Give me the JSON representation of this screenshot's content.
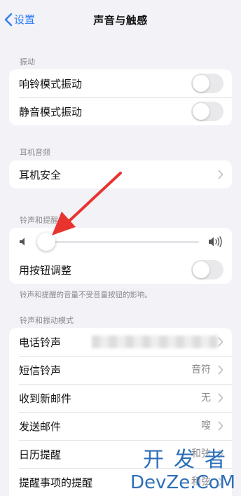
{
  "nav": {
    "back_label": "设置",
    "title": "声音与触感"
  },
  "vibration": {
    "header": "振动",
    "rows": [
      {
        "label": "响铃模式振动",
        "on": false
      },
      {
        "label": "静音模式振动",
        "on": false
      }
    ]
  },
  "headphone": {
    "header": "耳机音频",
    "rows": [
      {
        "label": "耳机安全"
      }
    ]
  },
  "ringer": {
    "header": "铃声和提醒",
    "volume_level": 0.0,
    "adjust_label": "用按钮调整",
    "adjust_on": false,
    "footnote": "铃声和提醒的音量不受音量按钮的影响。"
  },
  "patterns": {
    "header": "铃声和振动模式",
    "rows": [
      {
        "label": "电话铃声",
        "value": ""
      },
      {
        "label": "短信铃声",
        "value": "音符"
      },
      {
        "label": "收到新邮件",
        "value": "无"
      },
      {
        "label": "发送邮件",
        "value": "嗖"
      },
      {
        "label": "日历提醒",
        "value": "和弦"
      },
      {
        "label": "提醒事项的提醒",
        "value": "和弦"
      }
    ]
  },
  "watermark": {
    "line1": "开发者",
    "line2": "DevZe.CoM"
  },
  "colors": {
    "accent": "#2f7df6",
    "annotation_arrow": "#e8332f"
  }
}
